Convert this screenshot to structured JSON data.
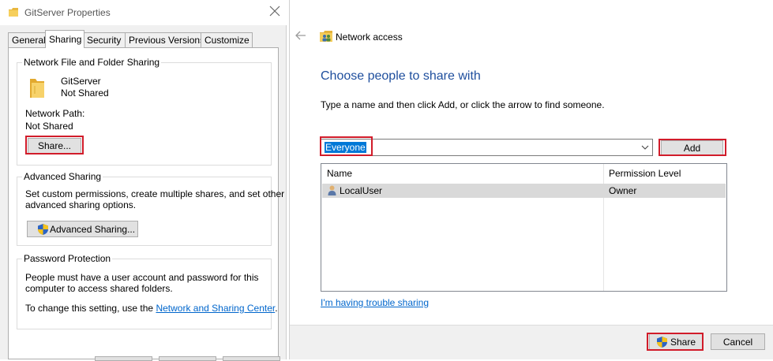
{
  "properties_window": {
    "title": "GitServer Properties",
    "tabs": [
      "General",
      "Sharing",
      "Security",
      "Previous Versions",
      "Customize"
    ],
    "active_tab": "Sharing",
    "network_sharing": {
      "group_title": "Network File and Folder Sharing",
      "folder_name": "GitServer",
      "folder_status": "Not Shared",
      "network_path_label": "Network Path:",
      "network_path_value": "Not Shared",
      "share_button": "Share..."
    },
    "advanced_sharing": {
      "group_title": "Advanced Sharing",
      "description_line1": "Set custom permissions, create multiple shares, and set other",
      "description_line2": "advanced sharing options.",
      "button": "Advanced Sharing..."
    },
    "password_protection": {
      "group_title": "Password Protection",
      "line1": "People must have a user account and password for this",
      "line2": "computer to access shared folders.",
      "line3_prefix": "To change this setting, use the ",
      "link": "Network and Sharing Center",
      "line3_suffix": "."
    }
  },
  "network_access_dialog": {
    "title": "Network access",
    "heading": "Choose people to share with",
    "instruction": "Type a name and then click Add, or click the arrow to find someone.",
    "input_value": "Everyone",
    "add_button": "Add",
    "columns": [
      "Name",
      "Permission Level"
    ],
    "rows": [
      {
        "name": "LocalUser",
        "permission": "Owner"
      }
    ],
    "trouble_link": "I'm having trouble sharing",
    "share_button": "Share",
    "cancel_button": "Cancel"
  },
  "colors": {
    "highlight_red": "#d11c2a",
    "selection_blue": "#0078d7",
    "heading_blue": "#1e4e9d",
    "link_blue": "#0066cc"
  },
  "icons": [
    "folder-icon",
    "close-icon",
    "shield-icon",
    "back-arrow-icon",
    "network-users-icon",
    "user-icon",
    "chevron-down-icon"
  ]
}
